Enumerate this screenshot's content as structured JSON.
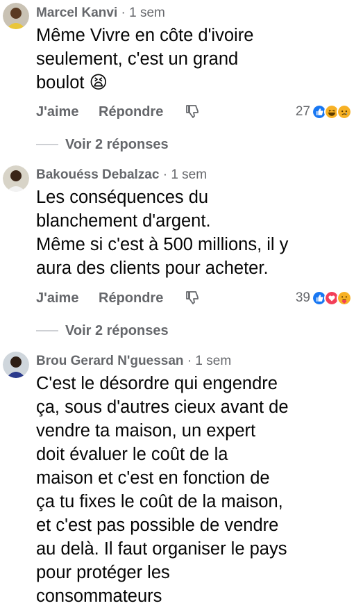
{
  "comments": [
    {
      "author": "Marcel Kanvi",
      "time": "1 sem",
      "text_lines": [
        "Même Vivre en côte d'ivoire",
        "seulement, c'est un grand",
        "boulot 😫"
      ],
      "like_label": "J'aime",
      "reply_label": "Répondre",
      "reaction_count": "27",
      "reactions": [
        "like-icon",
        "haha-icon",
        "sad-icon"
      ],
      "replies_label": "Voir 2 réponses"
    },
    {
      "author": "Bakouéss Debalzac",
      "time": "1 sem",
      "text_lines": [
        "Les conséquences du",
        "blanchement d'argent.",
        "Même si c'est à 500 millions, il y",
        "aura des clients pour acheter."
      ],
      "like_label": "J'aime",
      "reply_label": "Répondre",
      "reaction_count": "39",
      "reactions": [
        "like-icon",
        "love-icon",
        "care-icon"
      ],
      "replies_label": "Voir 2 réponses"
    },
    {
      "author": "Brou Gerard N'guessan",
      "time": "1 sem",
      "text_lines": [
        "C'est le désordre qui engendre",
        "ça, sous d'autres cieux avant de",
        "vendre ta maison, un expert",
        "doit évaluer le coût de la",
        "maison et c'est en fonction de",
        "ça tu fixes le coût de la maison,",
        "et c'est pas possible de vendre",
        "au delà. Il faut organiser le pays",
        "pour protéger les",
        "consommateurs"
      ]
    }
  ],
  "separator": "·",
  "colors": {
    "like": "#1877f2",
    "love": "#f33e58",
    "haha": "#f7b125",
    "meta": "#65676b"
  }
}
